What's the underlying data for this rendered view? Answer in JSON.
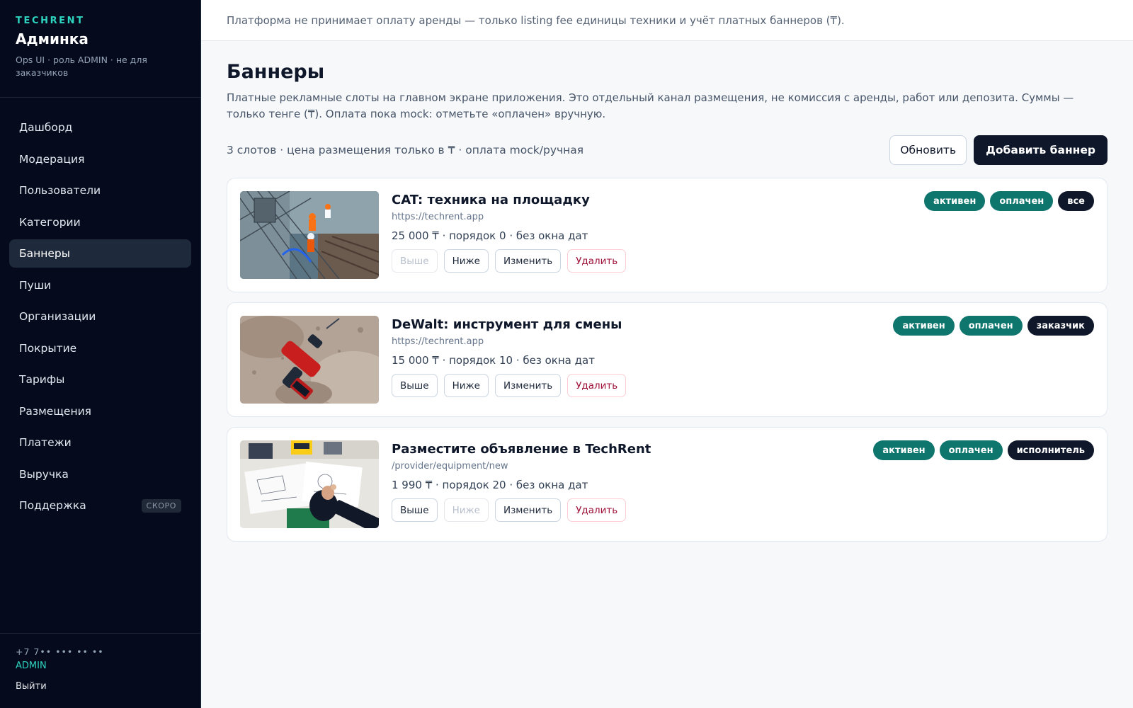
{
  "sidebar": {
    "kicker": "TECHRENT",
    "title": "Админка",
    "subtitle": "Ops UI · роль ADMIN · не для заказчиков",
    "items": [
      {
        "label": "Дашборд"
      },
      {
        "label": "Модерация"
      },
      {
        "label": "Пользователи"
      },
      {
        "label": "Категории"
      },
      {
        "label": "Баннеры",
        "active": true
      },
      {
        "label": "Пуши"
      },
      {
        "label": "Организации"
      },
      {
        "label": "Покрытие"
      },
      {
        "label": "Тарифы"
      },
      {
        "label": "Размещения"
      },
      {
        "label": "Платежи"
      },
      {
        "label": "Выручка"
      },
      {
        "label": "Поддержка",
        "badge": "СКОРО"
      }
    ],
    "footer": {
      "phone": "+7 7•• ••• •• ••",
      "role": "ADMIN",
      "logout": "Выйти"
    }
  },
  "notice": "Платформа не принимает оплату аренды — только listing fee единицы техники и учёт платных баннеров (₸).",
  "page": {
    "title": "Баннеры",
    "description": "Платные рекламные слоты на главном экране приложения. Это отдельный канал размещения, не комиссия с аренды, работ или депозита. Суммы — только тенге (₸). Оплата пока mock: отметьте «оплачен» вручную.",
    "toolbar_info": "3 слотов · цена размещения только в ₸ · оплата mock/ручная",
    "refresh_label": "Обновить",
    "add_label": "Добавить баннер"
  },
  "actions": {
    "up": "Выше",
    "down": "Ниже",
    "edit": "Изменить",
    "delete": "Удалить"
  },
  "banners": [
    {
      "title": "CAT: техника на площадку",
      "url": "https://techrent.app",
      "meta": "25 000 ₸ · порядок 0 · без окна дат",
      "up_disabled": true,
      "down_disabled": false,
      "badges": [
        {
          "label": "активен",
          "tone": "teal"
        },
        {
          "label": "оплачен",
          "tone": "teal"
        },
        {
          "label": "все",
          "tone": "dark"
        }
      ]
    },
    {
      "title": "DeWalt: инструмент для смены",
      "url": "https://techrent.app",
      "meta": "15 000 ₸ · порядок 10 · без окна дат",
      "up_disabled": false,
      "down_disabled": false,
      "badges": [
        {
          "label": "активен",
          "tone": "teal"
        },
        {
          "label": "оплачен",
          "tone": "teal"
        },
        {
          "label": "заказчик",
          "tone": "dark"
        }
      ]
    },
    {
      "title": "Разместите объявление в TechRent",
      "url": "/provider/equipment/new",
      "meta": "1 990 ₸ · порядок 20 · без окна дат",
      "up_disabled": false,
      "down_disabled": true,
      "badges": [
        {
          "label": "активен",
          "tone": "teal"
        },
        {
          "label": "оплачен",
          "tone": "teal"
        },
        {
          "label": "исполнитель",
          "tone": "dark"
        }
      ]
    }
  ]
}
